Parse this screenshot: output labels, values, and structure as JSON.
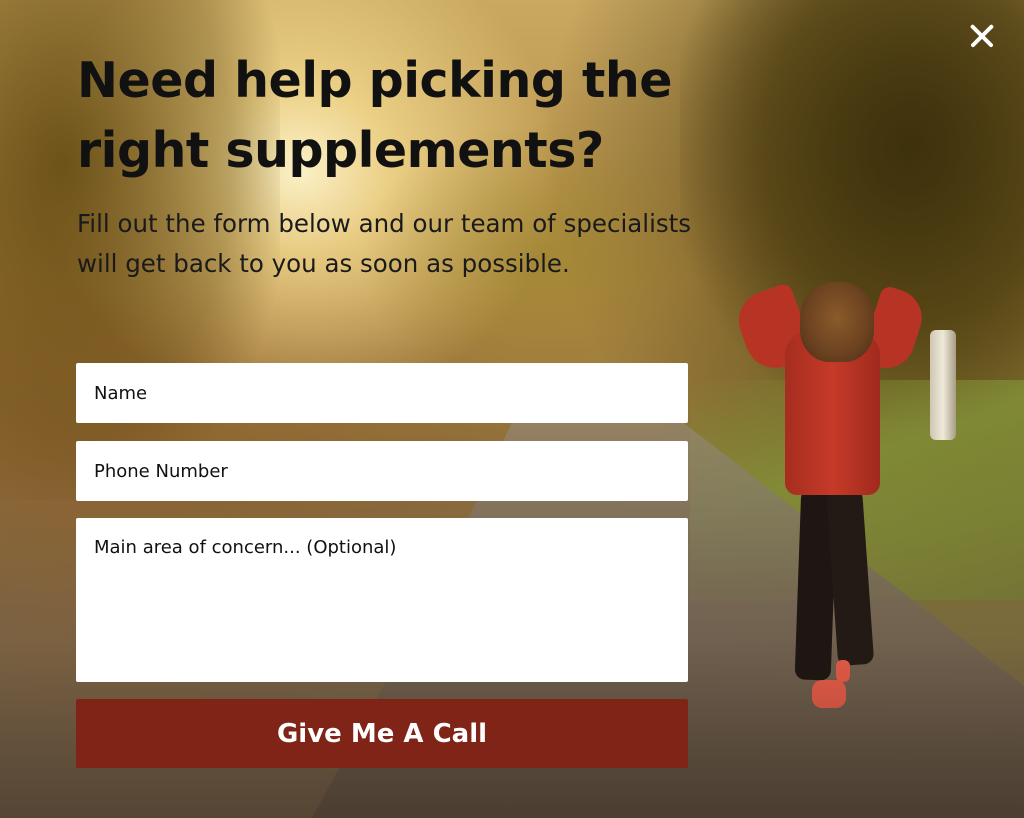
{
  "popup": {
    "close_icon": "close-icon",
    "headline": "Need help picking the right supplements?",
    "subtext": "Fill out the form below and our team of specialists will get back to you as soon as possible.",
    "form": {
      "name_placeholder": "Name",
      "phone_placeholder": "Phone Number",
      "concern_placeholder": "Main area of concern... (Optional)",
      "submit_label": "Give Me A Call"
    }
  },
  "colors": {
    "button_bg": "#7f2417",
    "button_text": "#ffffff",
    "headline_text": "#111111",
    "input_bg": "#ffffff"
  }
}
